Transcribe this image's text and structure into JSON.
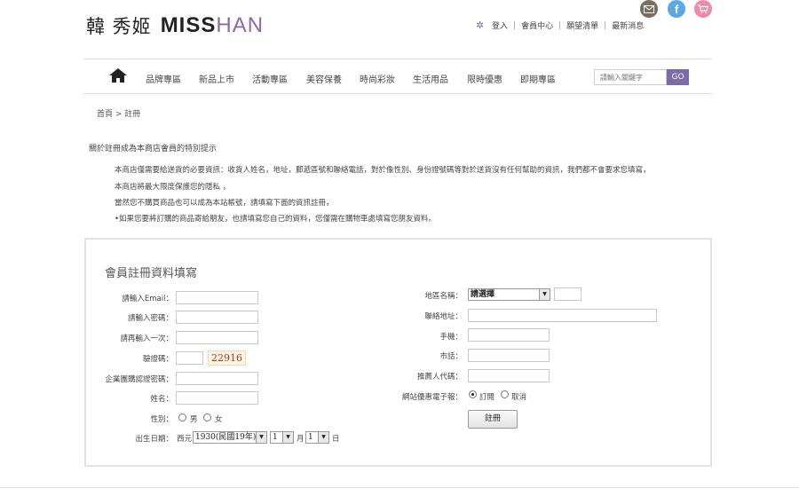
{
  "header": {
    "logo_cn": "韓  秀姬",
    "logo_en_miss": "MISS",
    "logo_en_han": "HAN",
    "links": [
      "登入",
      "會員中心",
      "願望清單",
      "最新消息"
    ],
    "icons": [
      "gear-icon",
      "mail-icon",
      "facebook-icon",
      "cart-icon"
    ],
    "brand_color": "#7d6aa8"
  },
  "nav": {
    "items": [
      "品牌專區",
      "新品上市",
      "活動專區",
      "美容保養",
      "時尚彩妝",
      "生活用品",
      "限時優惠",
      "即期專區"
    ],
    "search_placeholder": "請輸入關鍵字",
    "go_label": "GO"
  },
  "breadcrumb": "首頁 > 註冊",
  "notice": {
    "title": "關於註冊成為本商店會員的特別提示",
    "lines": [
      "本商店僅需要給送貨的必要資訊：收貨人姓名，地址，郵遞區號和聯絡電話，對於像性別、身份證號碼等對於送貨沒有任何幫助的資訊，我們都不會要求您填寫，",
      "本商店將最大限度保護您的隱私 ，",
      "當然您不購買商品也可以成為本站帳號，請填寫下面的資訊註冊，",
      "•如果您要將訂購的商品寄給朋友，也請填寫您自己的資料，您僅需在購物車處填寫您朋友資料。"
    ]
  },
  "form": {
    "title": "會員註冊資料填寫",
    "left": {
      "email_label": "請輸入Email：",
      "password_label": "請輸入密碼：",
      "password2_label": "請再輸入一次：",
      "captcha_label": "驗證碼：",
      "captcha_value": "22916",
      "corp_label": "企業團購認證密碼：",
      "name_label": "姓名：",
      "gender_label": "性別：",
      "gender_male": "男",
      "gender_female": "女",
      "birthday_label": "出生日期：",
      "birthday_prefix": "西元",
      "birthday_year": "1930(民國19年)",
      "birthday_month": "1",
      "birthday_month_unit": "月",
      "birthday_day": "1",
      "birthday_day_unit": "日"
    },
    "right": {
      "region_label": "地區名稱：",
      "region_value": "請選擇",
      "address_label": "聯絡地址：",
      "mobile_label": "手機：",
      "phone_label": "市話：",
      "referrer_label": "推薦人代碼：",
      "newsletter_label": "網站優惠電子報：",
      "subscribe": "訂閱",
      "cancel": "取消",
      "submit_label": "註冊"
    }
  }
}
